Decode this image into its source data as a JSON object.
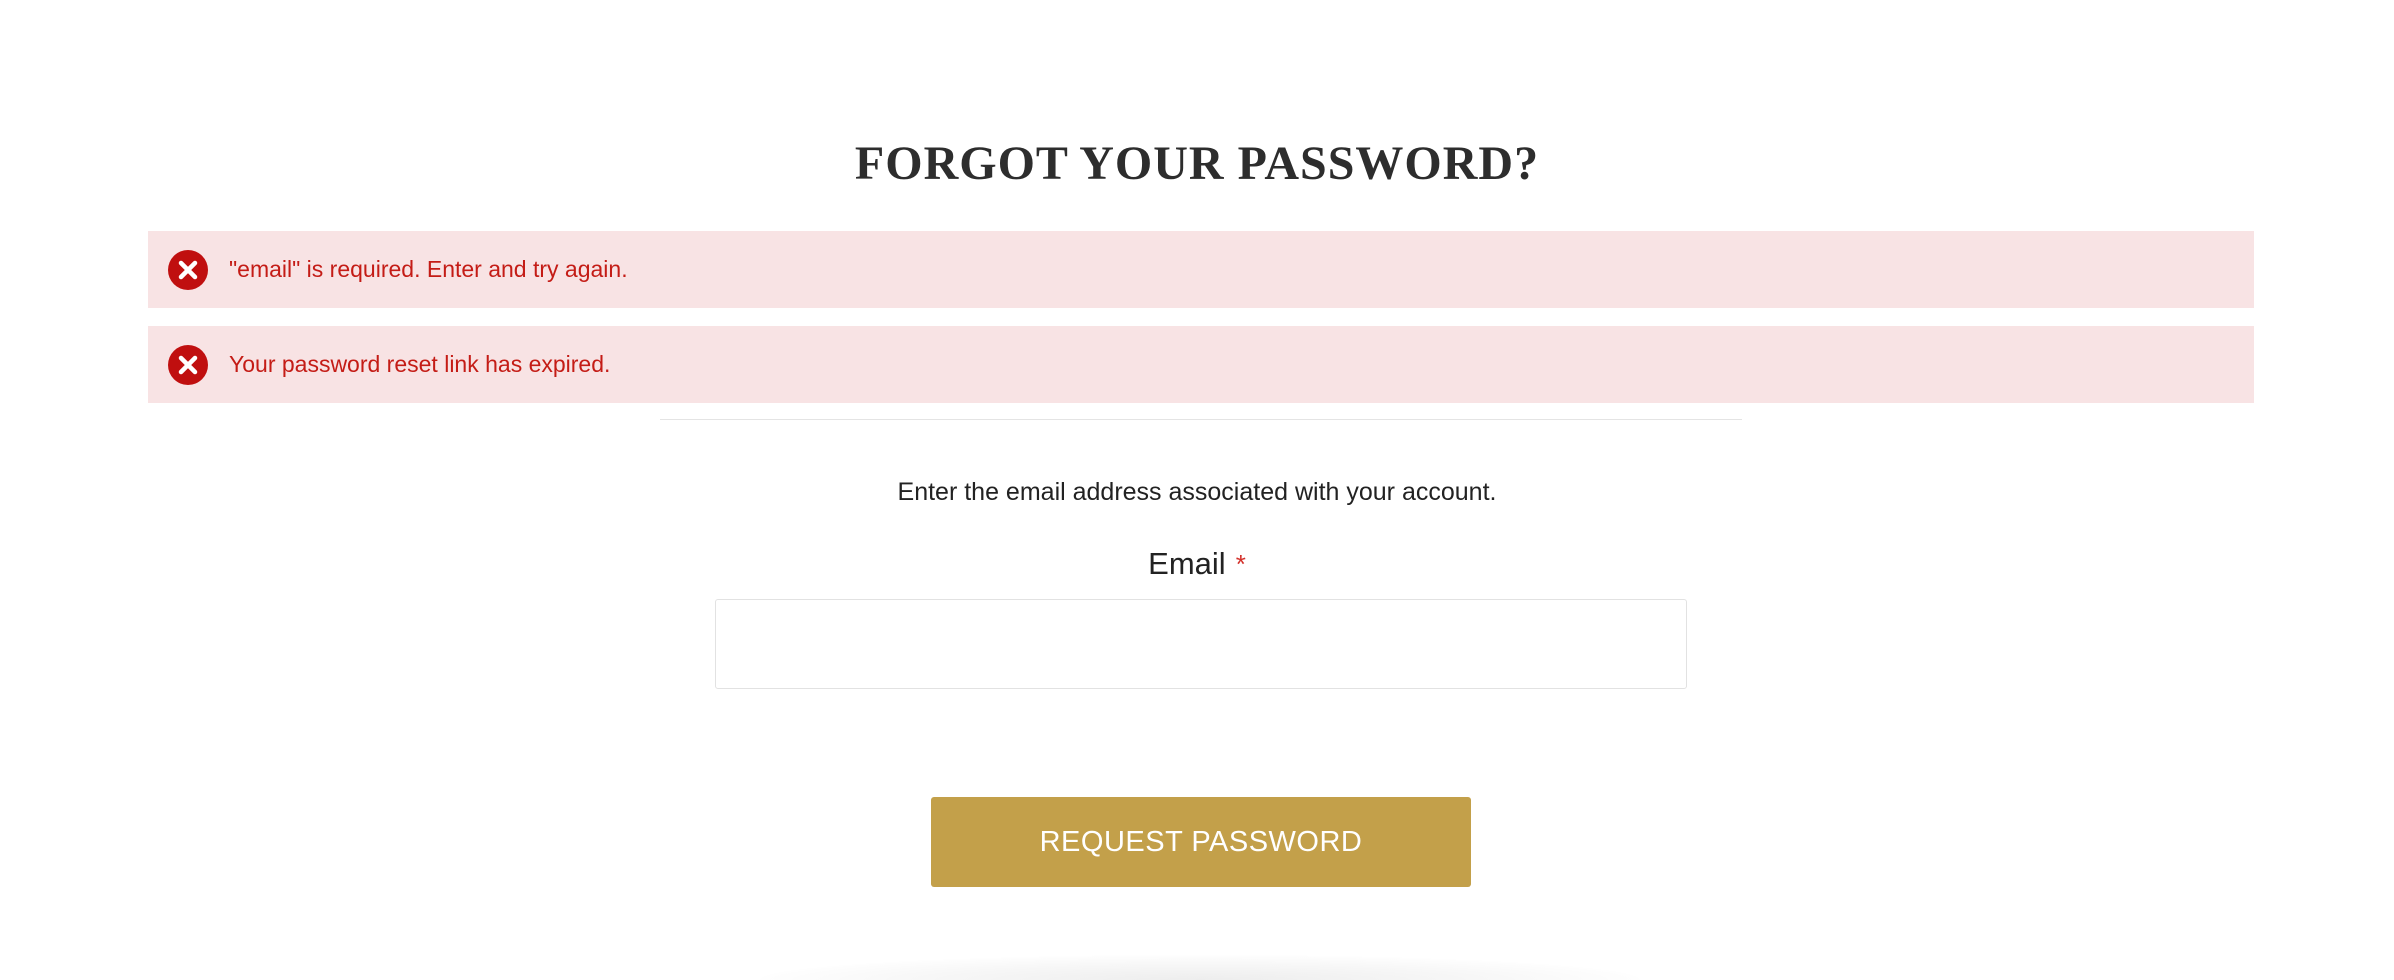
{
  "page": {
    "title": "FORGOT YOUR PASSWORD?"
  },
  "messages": [
    {
      "type": "error",
      "icon": "error-x-icon",
      "text": "\"email\" is required. Enter and try again."
    },
    {
      "type": "error",
      "icon": "error-x-icon",
      "text": "Your password reset link has expired."
    }
  ],
  "form": {
    "instructions": "Enter the email address associated with your account.",
    "email_label": "Email",
    "required_marker": "*",
    "email_value": "",
    "submit_label": "REQUEST PASSWORD"
  },
  "colors": {
    "error_background": "#f8e3e4",
    "error_text": "#c41c16",
    "error_icon": "#c00f0f",
    "button_background": "#c3a04a",
    "button_text": "#ffffff",
    "required_marker": "#d3302a"
  }
}
